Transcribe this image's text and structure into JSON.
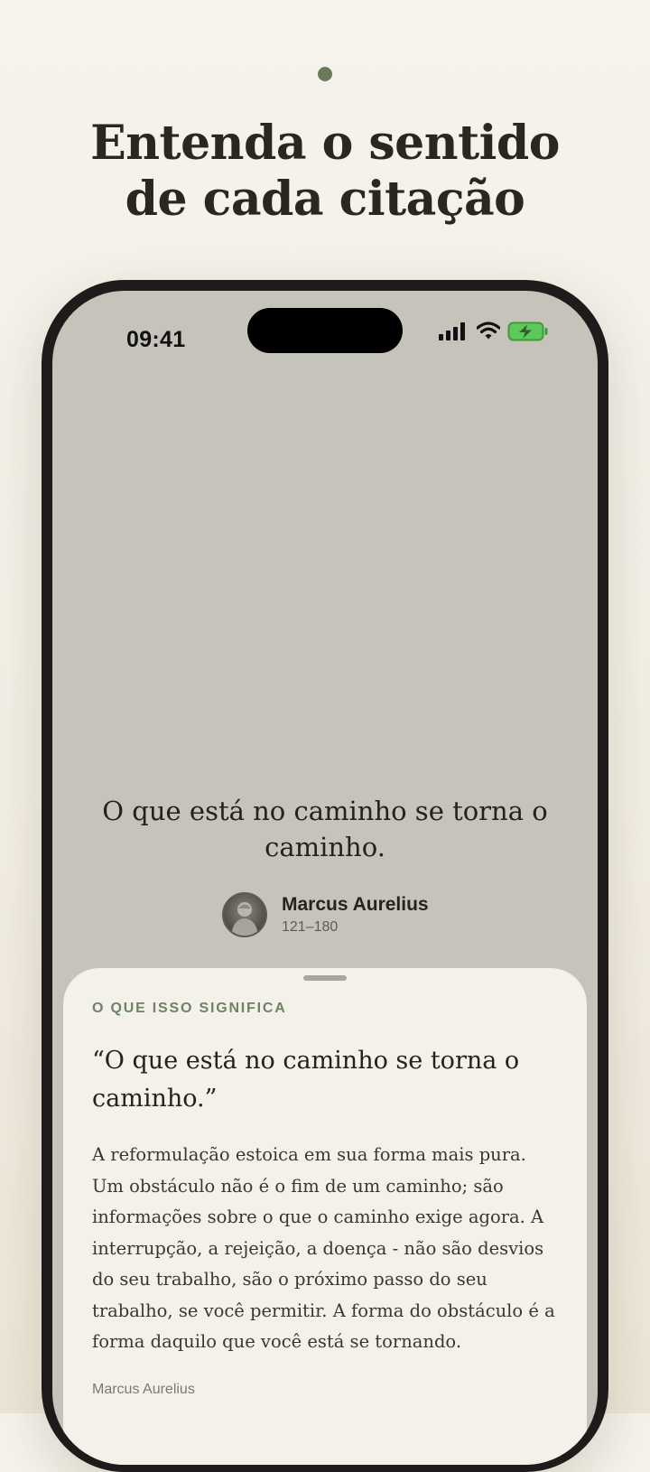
{
  "page": {
    "headline_line1": "Entenda o sentido",
    "headline_line2": "de cada citação",
    "accent_color": "#6b7a5a"
  },
  "status_bar": {
    "time": "09:41",
    "icons": [
      "signal-icon",
      "wifi-icon",
      "battery-charging-icon"
    ]
  },
  "quote": {
    "text": "O que está no caminho se torna o caminho.",
    "author": "Marcus Aurelius",
    "years": "121–180"
  },
  "meaning_sheet": {
    "label": "O QUE ISSO SIGNIFICA",
    "quote": "“O que está no caminho se torna o caminho.”",
    "body": "A reformulação estoica em sua forma mais pura. Um obstáculo não é o fim de um caminho; são informações sobre o que o caminho exige agora. A interrupção, a rejeição, a doença - não são desvios do seu trabalho, são o próximo passo do seu trabalho, se você permitir. A forma do obstáculo é a forma daquilo que você está se tornando.",
    "author": "Marcus Aurelius"
  }
}
